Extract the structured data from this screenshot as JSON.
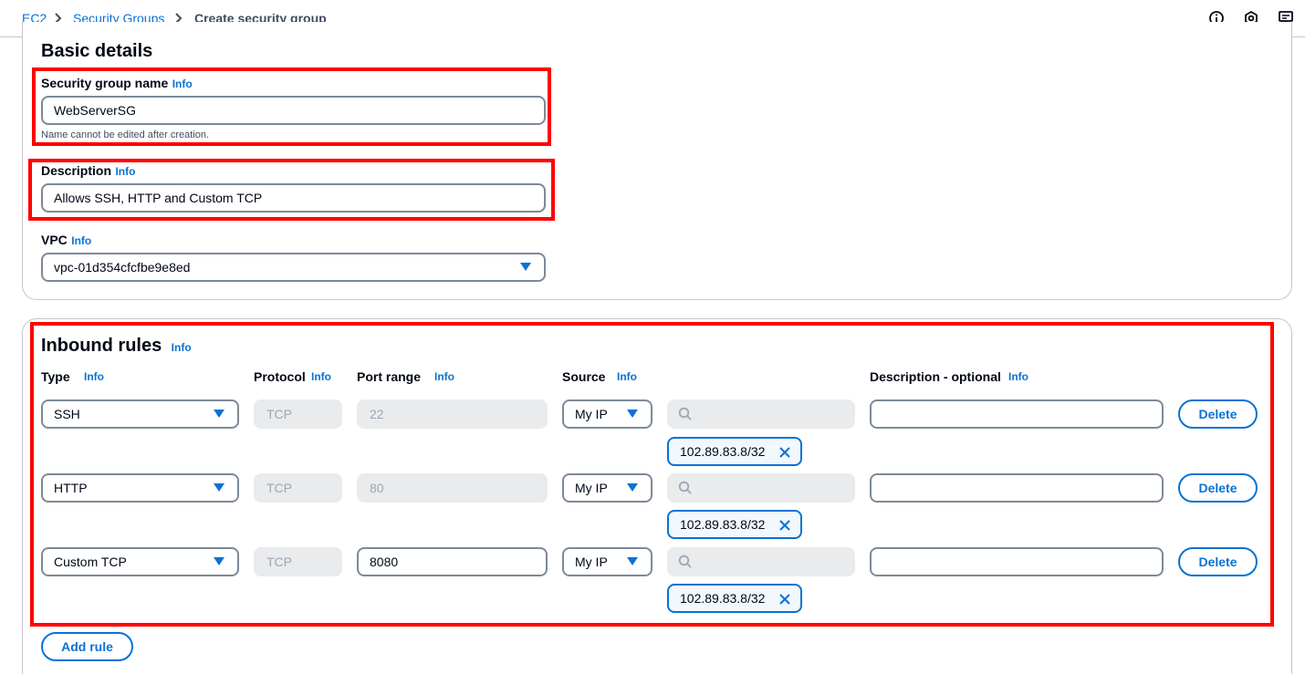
{
  "breadcrumb": {
    "items": [
      {
        "label": "EC2"
      },
      {
        "label": "Security Groups"
      },
      {
        "label": "Create security group"
      }
    ]
  },
  "header_icons": [
    "info-circle-icon",
    "settings-hexagon-icon",
    "feedback-icon"
  ],
  "basic_details": {
    "title": "Basic details",
    "name_field": {
      "label": "Security group name",
      "info": "Info",
      "value": "WebServerSG",
      "hint": "Name cannot be edited after creation."
    },
    "description_field": {
      "label": "Description",
      "info": "Info",
      "value": "Allows SSH, HTTP and Custom TCP"
    },
    "vpc_field": {
      "label": "VPC",
      "info": "Info",
      "value": "vpc-01d354cfcfbe9e8ed"
    }
  },
  "inbound_rules": {
    "title": "Inbound rules",
    "info": "Info",
    "columns": {
      "type": "Type",
      "protocol": "Protocol",
      "port_range": "Port range",
      "source": "Source",
      "description": "Description - optional",
      "info": "Info"
    },
    "rows": [
      {
        "type": "SSH",
        "protocol": "TCP",
        "port": "22",
        "source": "My IP",
        "cidr": "102.89.83.8/32",
        "description": "",
        "delete_label": "Delete"
      },
      {
        "type": "HTTP",
        "protocol": "TCP",
        "port": "80",
        "source": "My IP",
        "cidr": "102.89.83.8/32",
        "description": "",
        "delete_label": "Delete"
      },
      {
        "type": "Custom TCP",
        "protocol": "TCP",
        "port": "8080",
        "source": "My IP",
        "cidr": "102.89.83.8/32",
        "description": "",
        "delete_label": "Delete"
      }
    ],
    "add_rule_label": "Add rule"
  },
  "colors": {
    "link": "#0972d3",
    "highlight": "#ff0000",
    "border": "#7d8998",
    "disabled_bg": "#e9ebed"
  }
}
